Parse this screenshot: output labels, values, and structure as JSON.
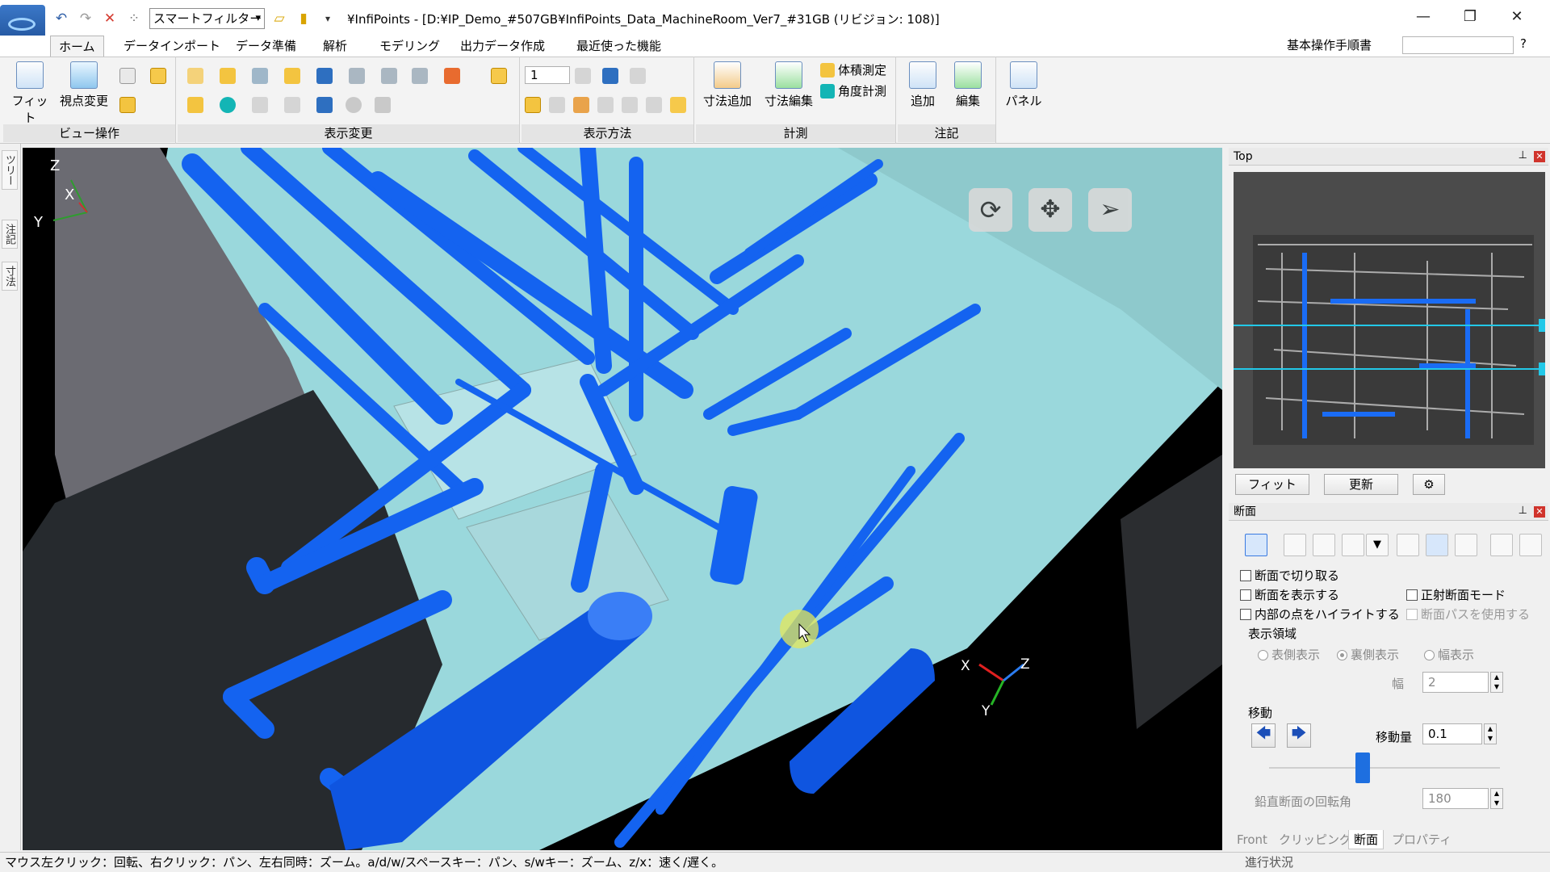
{
  "window": {
    "title": "¥InfiPoints - [D:¥IP_Demo_#507GB¥InfiPoints_Data_MachineRoom_Ver7_#31GB (リビジョン: 108)]",
    "smart_filter": "スマートフィルター",
    "controls": {
      "minimize": "—",
      "maximize": "❐",
      "close": "✕"
    }
  },
  "menu": {
    "tabs": [
      "ホーム",
      "データインポート",
      "データ準備",
      "解析",
      "モデリング",
      "出力データ作成",
      "最近使った機能"
    ],
    "active_tab": "ホーム",
    "manual": "基本操作手順書",
    "help": "?"
  },
  "ribbon": {
    "groups": {
      "view_ops": "ビュー操作",
      "display_change": "表示変更",
      "display_method": "表示方法",
      "measure": "計測",
      "annotation": "注記"
    },
    "buttons": {
      "fit": "フィット",
      "viewpoint": "視点変更",
      "point_size": "1",
      "dim_add": "寸法追加",
      "dim_edit": "寸法編集",
      "volume": "体積測定",
      "angle": "角度計測",
      "add": "追加",
      "edit": "編集",
      "panel": "パネル"
    }
  },
  "left_strip": {
    "tabs": [
      "ツリー",
      "注記",
      "寸法"
    ]
  },
  "viewport": {
    "axis_labels": {
      "z": "Z",
      "x": "X",
      "y": "Y"
    },
    "gizmo_labels": {
      "x": "X",
      "y": "Y",
      "z": "Z"
    },
    "colors": {
      "pipe": "#1463f0",
      "floor": "#9ad8dc",
      "wall": "#5a5a5a",
      "background": "#000000"
    }
  },
  "top_panel": {
    "title": "Top",
    "fit_button": "フィット",
    "refresh_button": "更新"
  },
  "section_panel": {
    "title": "断面",
    "checkboxes": {
      "cut_by_section": "断面で切り取る",
      "show_section": "断面を表示する",
      "ortho_mode": "正射断面モード",
      "highlight_inner": "内部の点をハイライトする",
      "use_section_path": "断面パスを使用する"
    },
    "display_area": {
      "label": "表示領域",
      "front": "表側表示",
      "back": "裏側表示",
      "width": "幅表示",
      "width_label": "幅",
      "width_value": "2"
    },
    "move": {
      "label": "移動",
      "amount_label": "移動量",
      "amount_value": "0.1",
      "slider_value": 0.4
    },
    "rotation": {
      "label": "鉛直断面の回転角",
      "value": "180"
    }
  },
  "bottom_tabs": [
    "Front",
    "クリッピング",
    "断面",
    "プロパティ"
  ],
  "bottom_active_tab": "断面",
  "status": {
    "hint": "マウス左クリック：回転、右クリック：パン、左右同時：ズーム。a/d/w/スペースキー：パン、s/wキー：ズーム、z/x：速く/遅く。",
    "progress_label": "進行状況"
  }
}
